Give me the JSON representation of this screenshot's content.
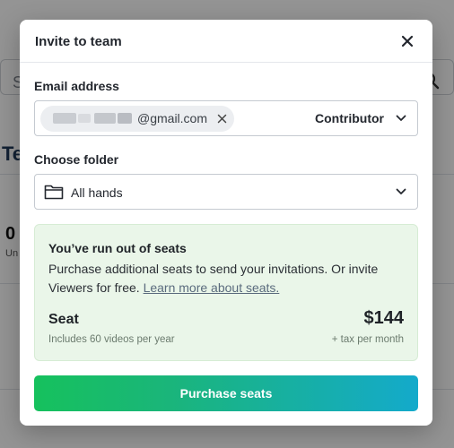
{
  "background": {
    "search_letter": "S",
    "title_fragment": "Te",
    "stat_value": "0",
    "stat_label_fragment": "Un"
  },
  "modal": {
    "title": "Invite to team",
    "email": {
      "label": "Email address",
      "chip_text": "@gmail.com",
      "role": "Contributor"
    },
    "folder": {
      "label": "Choose folder",
      "selected": "All hands"
    },
    "notice": {
      "title": "You’ve run out of seats",
      "body": "Purchase additional seats to send your invitations. Or invite Viewers for free.",
      "link": "Learn more about seats.",
      "seat_label": "Seat",
      "seat_price": "$144",
      "seat_sub": "Includes 60 videos per year",
      "seat_tax": "+ tax per month"
    },
    "purchase_label": "Purchase seats"
  },
  "icons": {
    "close": "close-icon",
    "chip_remove": "x-icon",
    "chevron": "chevron-down-icon",
    "folder": "folder-icon",
    "search": "search-icon"
  },
  "colors": {
    "overlay": "#00000069",
    "notice_bg": "#eaf6e9",
    "button_gradient_start": "#16c15d",
    "button_gradient_end": "#14aacb"
  }
}
